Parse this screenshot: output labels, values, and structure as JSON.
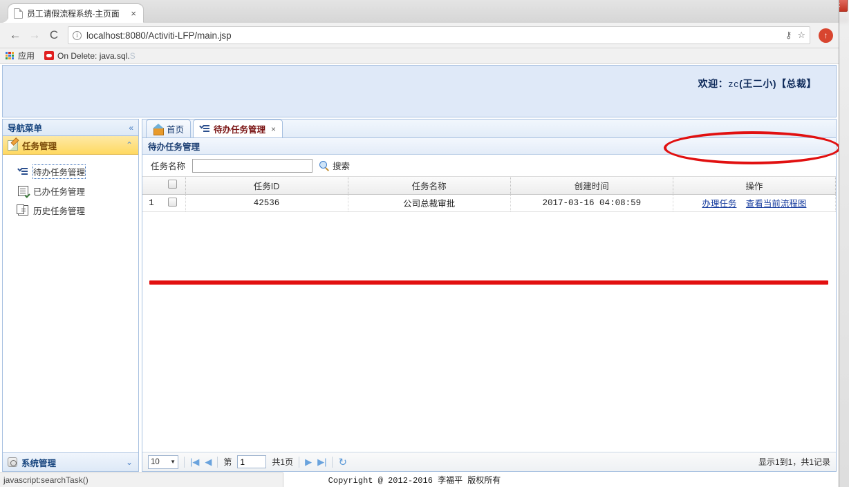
{
  "browser": {
    "tab_title": "员工请假流程系统-主页面",
    "tab_close": "×",
    "back_icon": "←",
    "forward_icon": "→",
    "reload_icon": "C",
    "info_icon": "i",
    "url": "localhost:8080/Activiti-LFP/main.jsp",
    "key_icon": "⚷",
    "star_icon": "☆",
    "update_icon": "↑",
    "bookmarks": {
      "apps_label": "应用",
      "items": [
        {
          "label": "On Delete: java.sql.",
          "label_faded": "S"
        }
      ]
    },
    "window_controls": {
      "minimize": "—",
      "maximize": "❐",
      "close": "✕"
    }
  },
  "app": {
    "welcome_prefix": "欢迎：",
    "welcome_user": "zc",
    "welcome_name": "(王二小)【总裁】"
  },
  "sidebar": {
    "header": {
      "title": "导航菜单",
      "collapse_icon": "«"
    },
    "accordion": {
      "title": "任务管理",
      "icon": "edit-icon",
      "chevron": "⌃"
    },
    "items": [
      {
        "label": "待办任务管理",
        "icon": "task-list-icon",
        "selected": true
      },
      {
        "label": "已办任务管理",
        "icon": "document-check-icon",
        "selected": false
      },
      {
        "label": "历史任务管理",
        "icon": "history-document-icon",
        "selected": false
      }
    ],
    "footer": {
      "title": "系统管理",
      "icon": "gear-icon",
      "chevron": "⌄"
    }
  },
  "tabs": [
    {
      "label": "首页",
      "icon": "home-icon",
      "active": false,
      "closable": false
    },
    {
      "label": "待办任务管理",
      "icon": "task-list-icon",
      "active": true,
      "closable": true,
      "close": "×"
    }
  ],
  "panel": {
    "title": "待办任务管理",
    "search": {
      "label": "任务名称",
      "value": "",
      "placeholder": "",
      "button_label": "搜索",
      "button_icon": "search-icon"
    }
  },
  "table": {
    "columns": [
      "",
      "",
      "任务ID",
      "任务名称",
      "创建时间",
      "操作"
    ],
    "rows": [
      {
        "rownum": "1",
        "checked": false,
        "task_id": "42536",
        "task_name": "公司总裁审批",
        "create_time": "2017-03-16 04:08:59",
        "actions": [
          "办理任务",
          "查看当前流程图"
        ]
      }
    ]
  },
  "pager": {
    "page_size": "10",
    "page_size_caret": "▼",
    "first_icon": "|◀",
    "prev_icon": "◀",
    "page_prefix": "第",
    "page_value": "1",
    "page_suffix": "共1页",
    "next_icon": "▶",
    "last_icon": "▶|",
    "refresh_icon": "↻",
    "info": "显示1到1，共1记录"
  },
  "footer": {
    "copyright": "Copyright @ 2012-2016 李福平 版权所有",
    "status_tip": "javascript:searchTask()"
  },
  "annotations": {
    "ellipse_color": "#e11010",
    "line_color": "#e21010"
  }
}
